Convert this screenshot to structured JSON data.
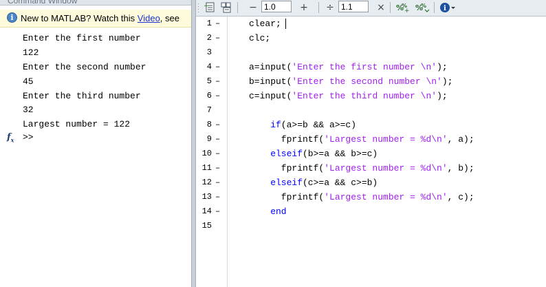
{
  "command_window": {
    "title": "Command Window",
    "info_bar": {
      "prefix": "New to MATLAB? Watch this ",
      "link": "Video",
      "suffix": ", see"
    },
    "output_lines": [
      "Enter the first number",
      "122",
      "Enter the second number",
      "45",
      "Enter the third number",
      "32",
      "Largest number = 122"
    ],
    "fx_label": "fx",
    "prompt": ">>"
  },
  "editor": {
    "toolbar": {
      "field_1": "1.0",
      "field_2": "1.1",
      "minus": "−",
      "plus": "+",
      "divide": "÷",
      "times": "×"
    },
    "lines": [
      {
        "num": "1",
        "dash": "–",
        "indent": 8,
        "tokens": [
          {
            "t": "clear;",
            "c": "code"
          }
        ]
      },
      {
        "num": "2",
        "dash": "–",
        "indent": 8,
        "tokens": [
          {
            "t": "clc;",
            "c": "code"
          }
        ]
      },
      {
        "num": "3",
        "dash": "",
        "indent": 8,
        "tokens": []
      },
      {
        "num": "4",
        "dash": "–",
        "indent": 8,
        "tokens": [
          {
            "t": "a=input(",
            "c": "code"
          },
          {
            "t": "'Enter the first number \\n'",
            "c": "str"
          },
          {
            "t": ");",
            "c": "code"
          }
        ]
      },
      {
        "num": "5",
        "dash": "–",
        "indent": 8,
        "tokens": [
          {
            "t": "b=input(",
            "c": "code"
          },
          {
            "t": "'Enter the second number \\n'",
            "c": "str"
          },
          {
            "t": ");",
            "c": "code"
          }
        ]
      },
      {
        "num": "6",
        "dash": "–",
        "indent": 8,
        "tokens": [
          {
            "t": "c=input(",
            "c": "code"
          },
          {
            "t": "'Enter the third number \\n'",
            "c": "str"
          },
          {
            "t": ");",
            "c": "code"
          }
        ]
      },
      {
        "num": "7",
        "dash": "",
        "indent": 8,
        "tokens": []
      },
      {
        "num": "8",
        "dash": "–",
        "indent": 12,
        "tokens": [
          {
            "t": "if",
            "c": "kw"
          },
          {
            "t": "(a>=b && a>=c)",
            "c": "code"
          }
        ]
      },
      {
        "num": "9",
        "dash": "–",
        "indent": 14,
        "tokens": [
          {
            "t": "fprintf(",
            "c": "code"
          },
          {
            "t": "'Largest number = %d\\n'",
            "c": "str"
          },
          {
            "t": ", a);",
            "c": "code"
          }
        ]
      },
      {
        "num": "10",
        "dash": "–",
        "indent": 12,
        "tokens": [
          {
            "t": "elseif",
            "c": "kw"
          },
          {
            "t": "(b>=a && b>=c)",
            "c": "code"
          }
        ]
      },
      {
        "num": "11",
        "dash": "–",
        "indent": 14,
        "tokens": [
          {
            "t": "fprintf(",
            "c": "code"
          },
          {
            "t": "'Largest number = %d\\n'",
            "c": "str"
          },
          {
            "t": ", b);",
            "c": "code"
          }
        ]
      },
      {
        "num": "12",
        "dash": "–",
        "indent": 12,
        "tokens": [
          {
            "t": "elseif",
            "c": "kw"
          },
          {
            "t": "(c>=a && c>=b)",
            "c": "code"
          }
        ]
      },
      {
        "num": "13",
        "dash": "–",
        "indent": 14,
        "tokens": [
          {
            "t": "fprintf(",
            "c": "code"
          },
          {
            "t": "'Largest number = %d\\n'",
            "c": "str"
          },
          {
            "t": ", c);",
            "c": "code"
          }
        ]
      },
      {
        "num": "14",
        "dash": "–",
        "indent": 12,
        "tokens": [
          {
            "t": "end",
            "c": "kw"
          }
        ]
      },
      {
        "num": "15",
        "dash": "",
        "indent": 8,
        "tokens": []
      }
    ]
  },
  "colors": {
    "keyword": "#0000ff",
    "string": "#a020f0",
    "code": "#000000",
    "info_bar_bg": "#fdfbdc",
    "toolbar_bg": "#e7ecf1"
  }
}
